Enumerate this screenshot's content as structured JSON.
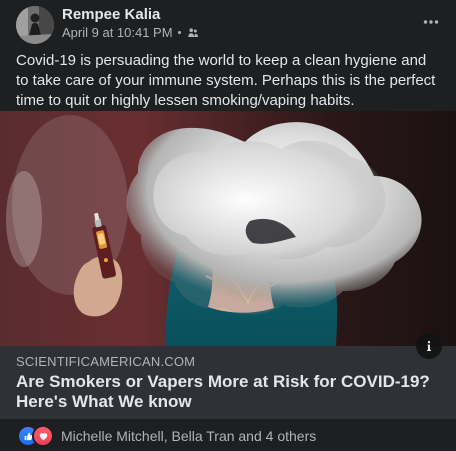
{
  "post": {
    "author": "Rempee Kalia",
    "timestamp": "April 9 at 10:41 PM",
    "audience_icon": "friends-icon",
    "message": "Covid-19 is persuading the world to keep a clean hygiene and to take care of your immune system. Perhaps this is the perfect time to quit or highly lessen smoking/vaping habits."
  },
  "media": {
    "subject": "person exhaling a large vapor cloud while holding a vape"
  },
  "link_preview": {
    "domain": "SCIENTIFICAMERICAN.COM",
    "headline": "Are Smokers or Vapers More at Risk for COVID-19? Here's What We know"
  },
  "reactions": {
    "summary": "Michelle Mitchell, Bella Tran and 4 others",
    "types": [
      "like",
      "love"
    ]
  },
  "colors": {
    "background": "#1e1f21",
    "text_primary": "#e4e6eb",
    "text_secondary": "#b0b3b8",
    "preview_background": "#2f3136",
    "like": "#1d6df2",
    "love": "#f33e58"
  }
}
